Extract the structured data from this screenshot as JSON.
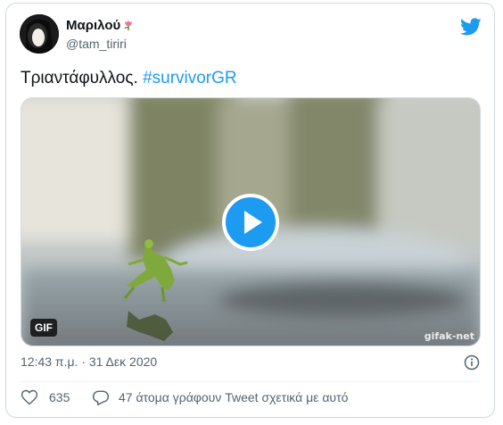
{
  "user": {
    "display_name": "Μαριλού",
    "handle": "@tam_tiriri"
  },
  "tweet": {
    "text": "Τριαντάφυλλος.",
    "hashtag": "#survivorGR"
  },
  "media": {
    "badge": "GIF",
    "watermark": "gifak-net"
  },
  "meta": {
    "timestamp": "12:43 π.μ. · 31 Δεκ 2020"
  },
  "actions": {
    "like_count": "635",
    "reply_text": "47 άτομα γράφουν Tweet σχετικά με αυτό"
  },
  "colors": {
    "accent": "#1d9bf0",
    "text": "#0f1419",
    "muted": "#536471"
  },
  "icons": [
    "rose-icon",
    "twitter-bird-icon",
    "play-icon",
    "info-icon",
    "heart-icon",
    "reply-icon"
  ]
}
